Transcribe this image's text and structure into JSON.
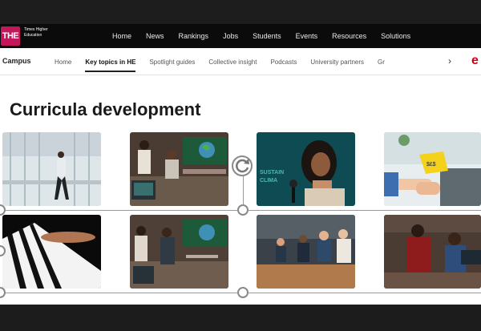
{
  "logo": {
    "mark": "THE",
    "text": "Times Higher Education"
  },
  "main_nav": [
    "Home",
    "News",
    "Rankings",
    "Jobs",
    "Students",
    "Events",
    "Resources",
    "Solutions"
  ],
  "sub_nav": {
    "brand": "Campus",
    "links": [
      "Home",
      "Key topics in HE",
      "Spotlight guides",
      "Collective insight",
      "Podcasts",
      "University partners",
      "Gr"
    ],
    "active": "Key topics in HE"
  },
  "page": {
    "title": "Curricula development"
  },
  "icons": [
    "chevron-right-icon",
    "logo-e-icon",
    "rotate-icon"
  ],
  "colors": {
    "brand": "#c2185b",
    "accent": "#d0021b"
  }
}
